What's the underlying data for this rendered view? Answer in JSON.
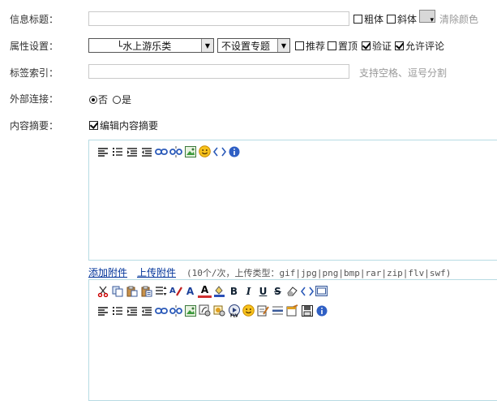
{
  "form": {
    "title_label": "信息标题：",
    "bold_label": "粗体",
    "italic_label": "斜体",
    "clear_color_label": "清除颜色",
    "attr_label": "属性设置：",
    "category_value": "└水上游乐类",
    "topic_value": "不设置专题",
    "recommend_label": "推荐",
    "top_label": "置顶",
    "verify_label": "验证",
    "allow_comment_label": "允许评论",
    "tag_label": "标签索引：",
    "tag_hint": "支持空格、逗号分割",
    "external_label": "外部连接：",
    "no_label": "否",
    "yes_label": "是",
    "summary_label": "内容摘要：",
    "edit_summary_label": "编辑内容摘要"
  },
  "attachments": {
    "add_link": "添加附件",
    "upload_link": "上传附件",
    "info": "(10个/次，上传类型：gif|jpg|png|bmp|rar|zip|flv|swf)"
  },
  "toolbar_glyphs": {
    "bold": "B",
    "italic": "I",
    "underline": "U",
    "strike": "S",
    "font_size": "A",
    "font_color": "A"
  },
  "icons": {
    "align_left": "align-left-icon",
    "list": "list-icon",
    "indent": "indent-icon",
    "outdent": "outdent-icon",
    "link": "link-icon",
    "unlink": "unlink-icon",
    "image": "image-icon",
    "emoticon": "emoticon-icon",
    "source": "source-code-icon",
    "about": "about-icon"
  },
  "colors": {
    "editor_border": "#b7dbe3",
    "link": "#003399",
    "hint": "#999999"
  }
}
